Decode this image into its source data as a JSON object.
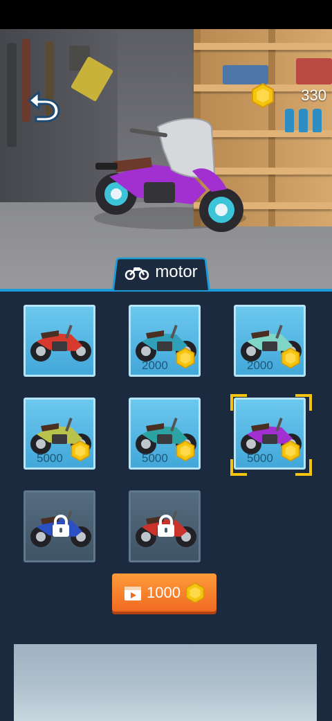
{
  "hud": {
    "coins": "330",
    "back_icon": "undo-arrow-icon",
    "coin_icon": "gold-coin-icon"
  },
  "category_tab": {
    "label": "motor",
    "icon": "motorbike-icon"
  },
  "bikes": [
    {
      "name": "red-dirt-bike",
      "price": "",
      "state": "owned",
      "color": "#d63a2f"
    },
    {
      "name": "teal-cruiser",
      "price": "2000",
      "state": "for-sale",
      "color": "#2fa0b8"
    },
    {
      "name": "mint-scooter",
      "price": "2000",
      "state": "for-sale",
      "color": "#7fd6c6"
    },
    {
      "name": "olive-classic",
      "price": "5000",
      "state": "for-sale",
      "color": "#b9c24a"
    },
    {
      "name": "teal-classic",
      "price": "5000",
      "state": "for-sale",
      "color": "#2ba3a3"
    },
    {
      "name": "purple-cafe-racer",
      "price": "5000",
      "state": "selected",
      "color": "#a22fd0"
    },
    {
      "name": "blue-sport-bike",
      "price": "",
      "state": "locked",
      "color": "#2d4fc4"
    },
    {
      "name": "red-sport-bike",
      "price": "",
      "state": "locked",
      "color": "#c9332c"
    }
  ],
  "unlock_button": {
    "amount": "1000",
    "icon": "video-ad-icon"
  },
  "colors": {
    "panel": "#1b2a3f",
    "accent": "#1b9bd8",
    "coin": "#f5c40f",
    "button": "#f07a2a"
  }
}
